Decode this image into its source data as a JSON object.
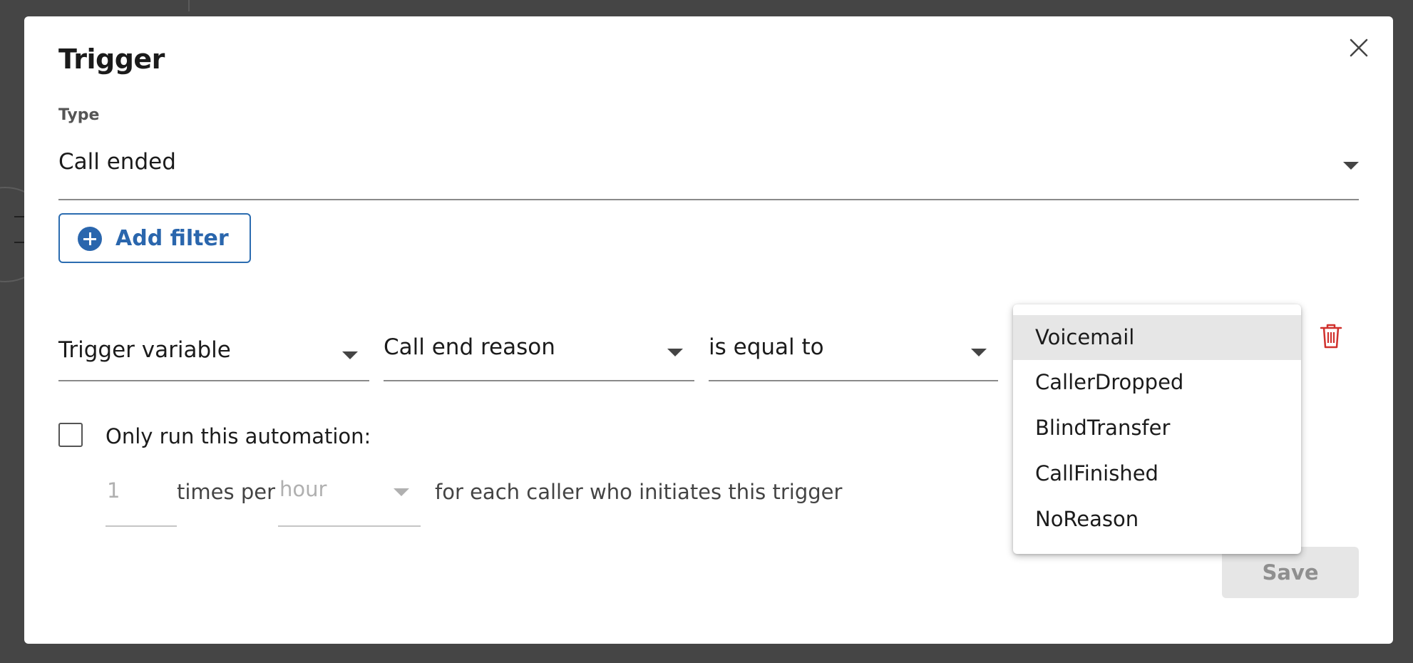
{
  "dialog": {
    "title": "Trigger",
    "type_label": "Type",
    "type_value": "Call ended",
    "add_filter_label": "Add filter"
  },
  "filter": {
    "source": "Trigger variable",
    "variable": "Call end reason",
    "operator": "is equal to"
  },
  "dropdown": {
    "options": [
      "Voicemail",
      "CallerDropped",
      "BlindTransfer",
      "CallFinished",
      "NoReason"
    ],
    "highlighted": "Voicemail"
  },
  "rate_limit": {
    "checkbox_label": "Only run this automation:",
    "count": "1",
    "times_per_label": "times per",
    "period": "hour",
    "suffix": "for each caller who initiates this trigger"
  },
  "footer": {
    "save_label": "Save"
  },
  "colors": {
    "accent": "#2a66ad",
    "danger": "#d0312d",
    "overlay": "#454545",
    "highlight": "#e6e6e6"
  },
  "icons": {
    "close": "close-icon",
    "add": "plus-circle-icon",
    "delete": "trash-icon",
    "dropdown": "caret-down-icon"
  }
}
